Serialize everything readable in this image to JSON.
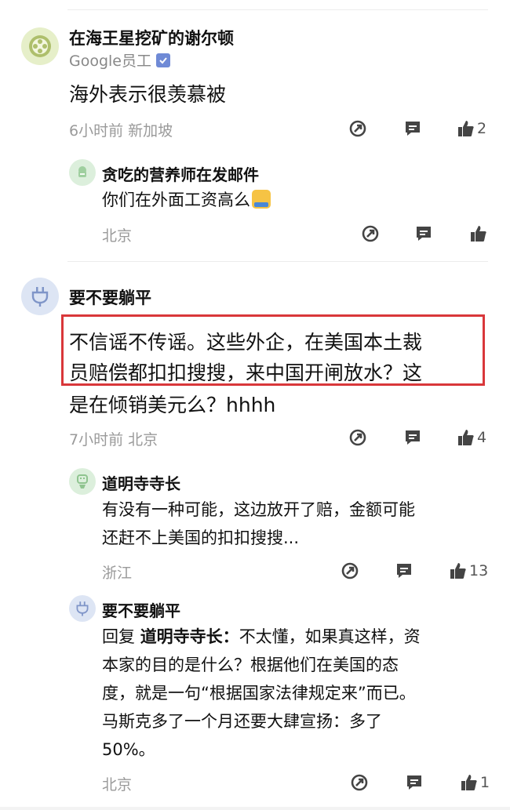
{
  "comments": [
    {
      "username": "在海王星挖矿的谢尔顿",
      "subtitle": "Google员工",
      "content": [
        "海外表示很羡慕被"
      ],
      "meta": "6小时前  新加坡",
      "likes": "2",
      "replies": [
        {
          "username": "贪吃的营养师在发邮件",
          "content": [
            "你们在外面工资高么"
          ],
          "meta": "北京",
          "likes": ""
        }
      ]
    },
    {
      "username": "要不要躺平",
      "content": [
        "不信谣不传谣。这些外企，在美国本土裁",
        "员赔偿都扣扣搜搜，来中国开闸放水？这",
        "是在倾销美元么？hhhh"
      ],
      "meta": "7小时前  北京",
      "likes": "4",
      "replies": [
        {
          "username": "道明寺寺长",
          "content": [
            "有没有一种可能，这边放开了赔，金额可能",
            "还赶不上美国的扣扣搜搜..."
          ],
          "meta": "浙江",
          "likes": "13"
        },
        {
          "username": "要不要躺平",
          "reply_prefix": "回复 ",
          "reply_to": "道明寺寺长：",
          "content": [
            "不太懂，如果真这样，资",
            "本家的目的是什么？根据他们在美国的态",
            "度，就是一句“根据国家法律规定来”而已。",
            "马斯克多了一个月还要大肆宣扬：多了",
            "50%。"
          ],
          "meta": "北京",
          "likes": "1"
        }
      ]
    }
  ],
  "icons": {
    "share": "share-icon",
    "comment": "comment-icon",
    "like": "thumbs-up-icon",
    "verified": "verified-badge-icon"
  },
  "colors": {
    "highlight_border": "#d9373a",
    "icon": "#444444",
    "meta_text": "#9a9a9a"
  }
}
